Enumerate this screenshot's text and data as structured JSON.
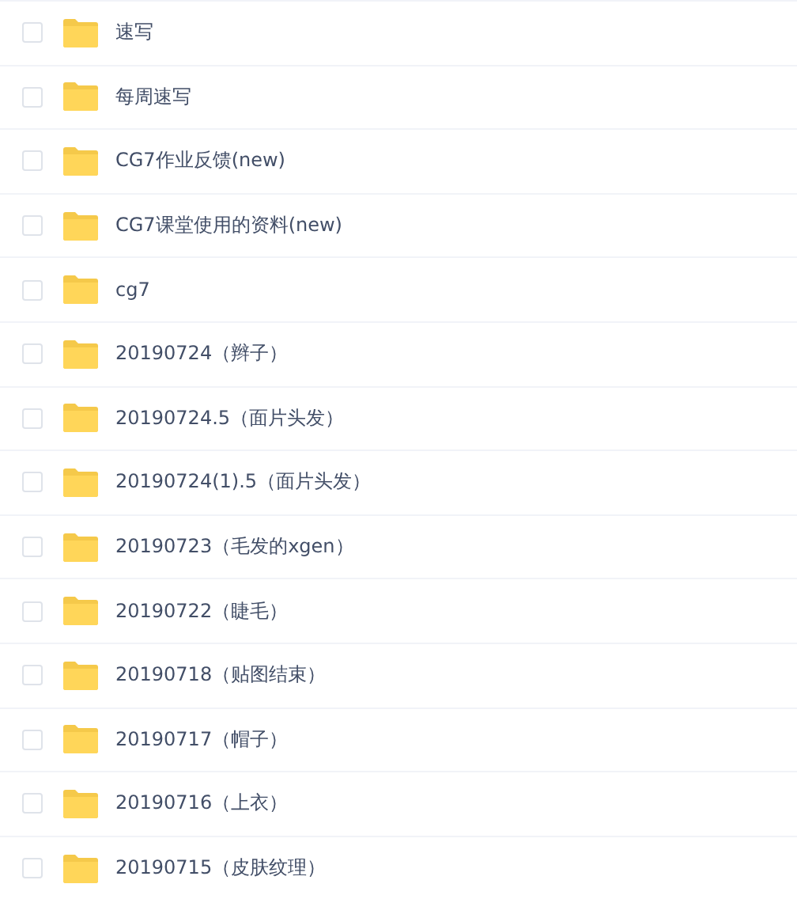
{
  "files": [
    {
      "name": "速写",
      "checked": false
    },
    {
      "name": "每周速写",
      "checked": false
    },
    {
      "name": "CG7作业反馈(new)",
      "checked": false
    },
    {
      "name": "CG7课堂使用的资料(new)",
      "checked": false
    },
    {
      "name": "cg7",
      "checked": false
    },
    {
      "name": "20190724（辫子）",
      "checked": false
    },
    {
      "name": "20190724.5（面片头发）",
      "checked": false
    },
    {
      "name": "20190724(1).5（面片头发）",
      "checked": false
    },
    {
      "name": "20190723（毛发的xgen）",
      "checked": false
    },
    {
      "name": "20190722（睫毛）",
      "checked": false
    },
    {
      "name": "20190718（贴图结束）",
      "checked": false
    },
    {
      "name": "20190717（帽子）",
      "checked": false
    },
    {
      "name": "20190716（上衣）",
      "checked": false
    },
    {
      "name": "20190715（皮肤纹理）",
      "checked": false
    }
  ]
}
